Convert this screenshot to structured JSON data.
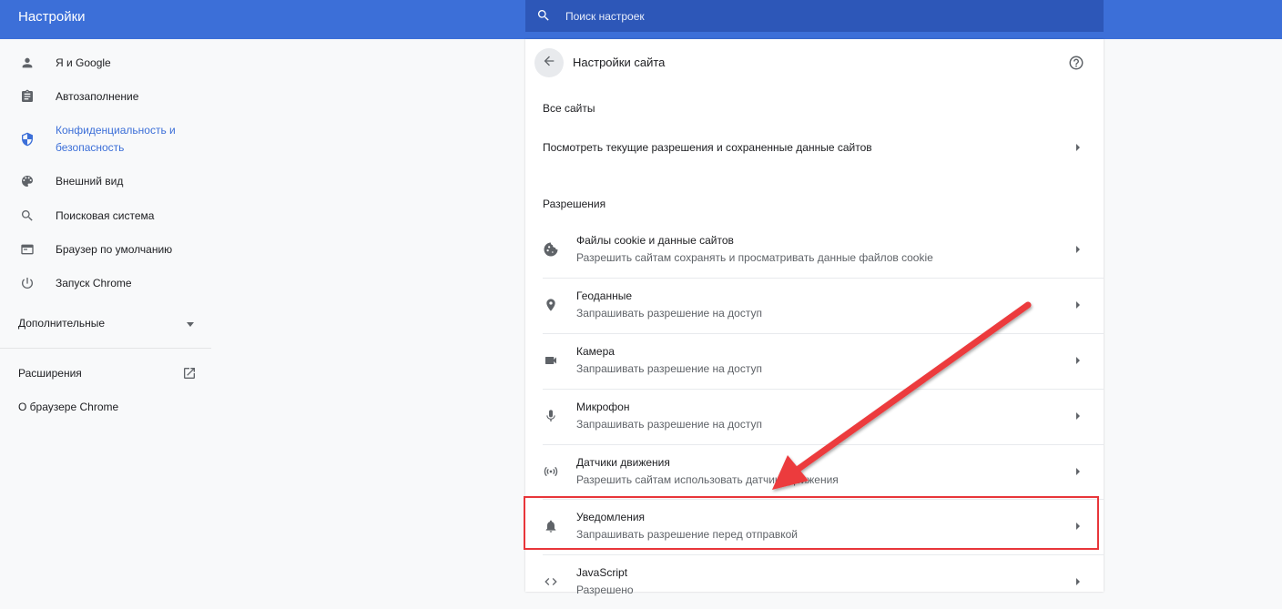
{
  "app": {
    "title": "Настройки"
  },
  "search": {
    "placeholder": "Поиск настроек"
  },
  "sidebar": {
    "items": [
      {
        "label": "Я и Google",
        "icon": "person-icon"
      },
      {
        "label": "Автозаполнение",
        "icon": "clipboard-icon"
      },
      {
        "label": "Конфиденциальность и безопасность",
        "icon": "shield-icon",
        "active": true
      },
      {
        "label": "Внешний вид",
        "icon": "palette-icon"
      },
      {
        "label": "Поисковая система",
        "icon": "search-icon"
      },
      {
        "label": "Браузер по умолчанию",
        "icon": "browser-icon"
      },
      {
        "label": "Запуск Chrome",
        "icon": "power-icon"
      }
    ],
    "advanced": "Дополнительные",
    "extensions": "Расширения",
    "about": "О браузере Chrome"
  },
  "main": {
    "title": "Настройки сайта",
    "all_sites_header": "Все сайты",
    "all_sites_link": "Посмотреть текущие разрешения и сохраненные данные сайтов",
    "permissions_header": "Разрешения",
    "permissions": [
      {
        "title": "Файлы cookie и данные сайтов",
        "subtitle": "Разрешить сайтам сохранять и просматривать данные файлов cookie",
        "icon": "cookie-icon"
      },
      {
        "title": "Геоданные",
        "subtitle": "Запрашивать разрешение на доступ",
        "icon": "location-icon"
      },
      {
        "title": "Камера",
        "subtitle": "Запрашивать разрешение на доступ",
        "icon": "camera-icon"
      },
      {
        "title": "Микрофон",
        "subtitle": "Запрашивать разрешение на доступ",
        "icon": "microphone-icon"
      },
      {
        "title": "Датчики движения",
        "subtitle": "Разрешить сайтам использовать датчики движения",
        "icon": "motion-sensor-icon"
      },
      {
        "title": "Уведомления",
        "subtitle": "Запрашивать разрешение перед отправкой",
        "icon": "bell-icon",
        "highlighted": true
      },
      {
        "title": "JavaScript",
        "subtitle": "Разрешено",
        "icon": "code-icon"
      }
    ]
  },
  "colors": {
    "accent": "#3c6fd8",
    "highlight": "#e8363a"
  }
}
